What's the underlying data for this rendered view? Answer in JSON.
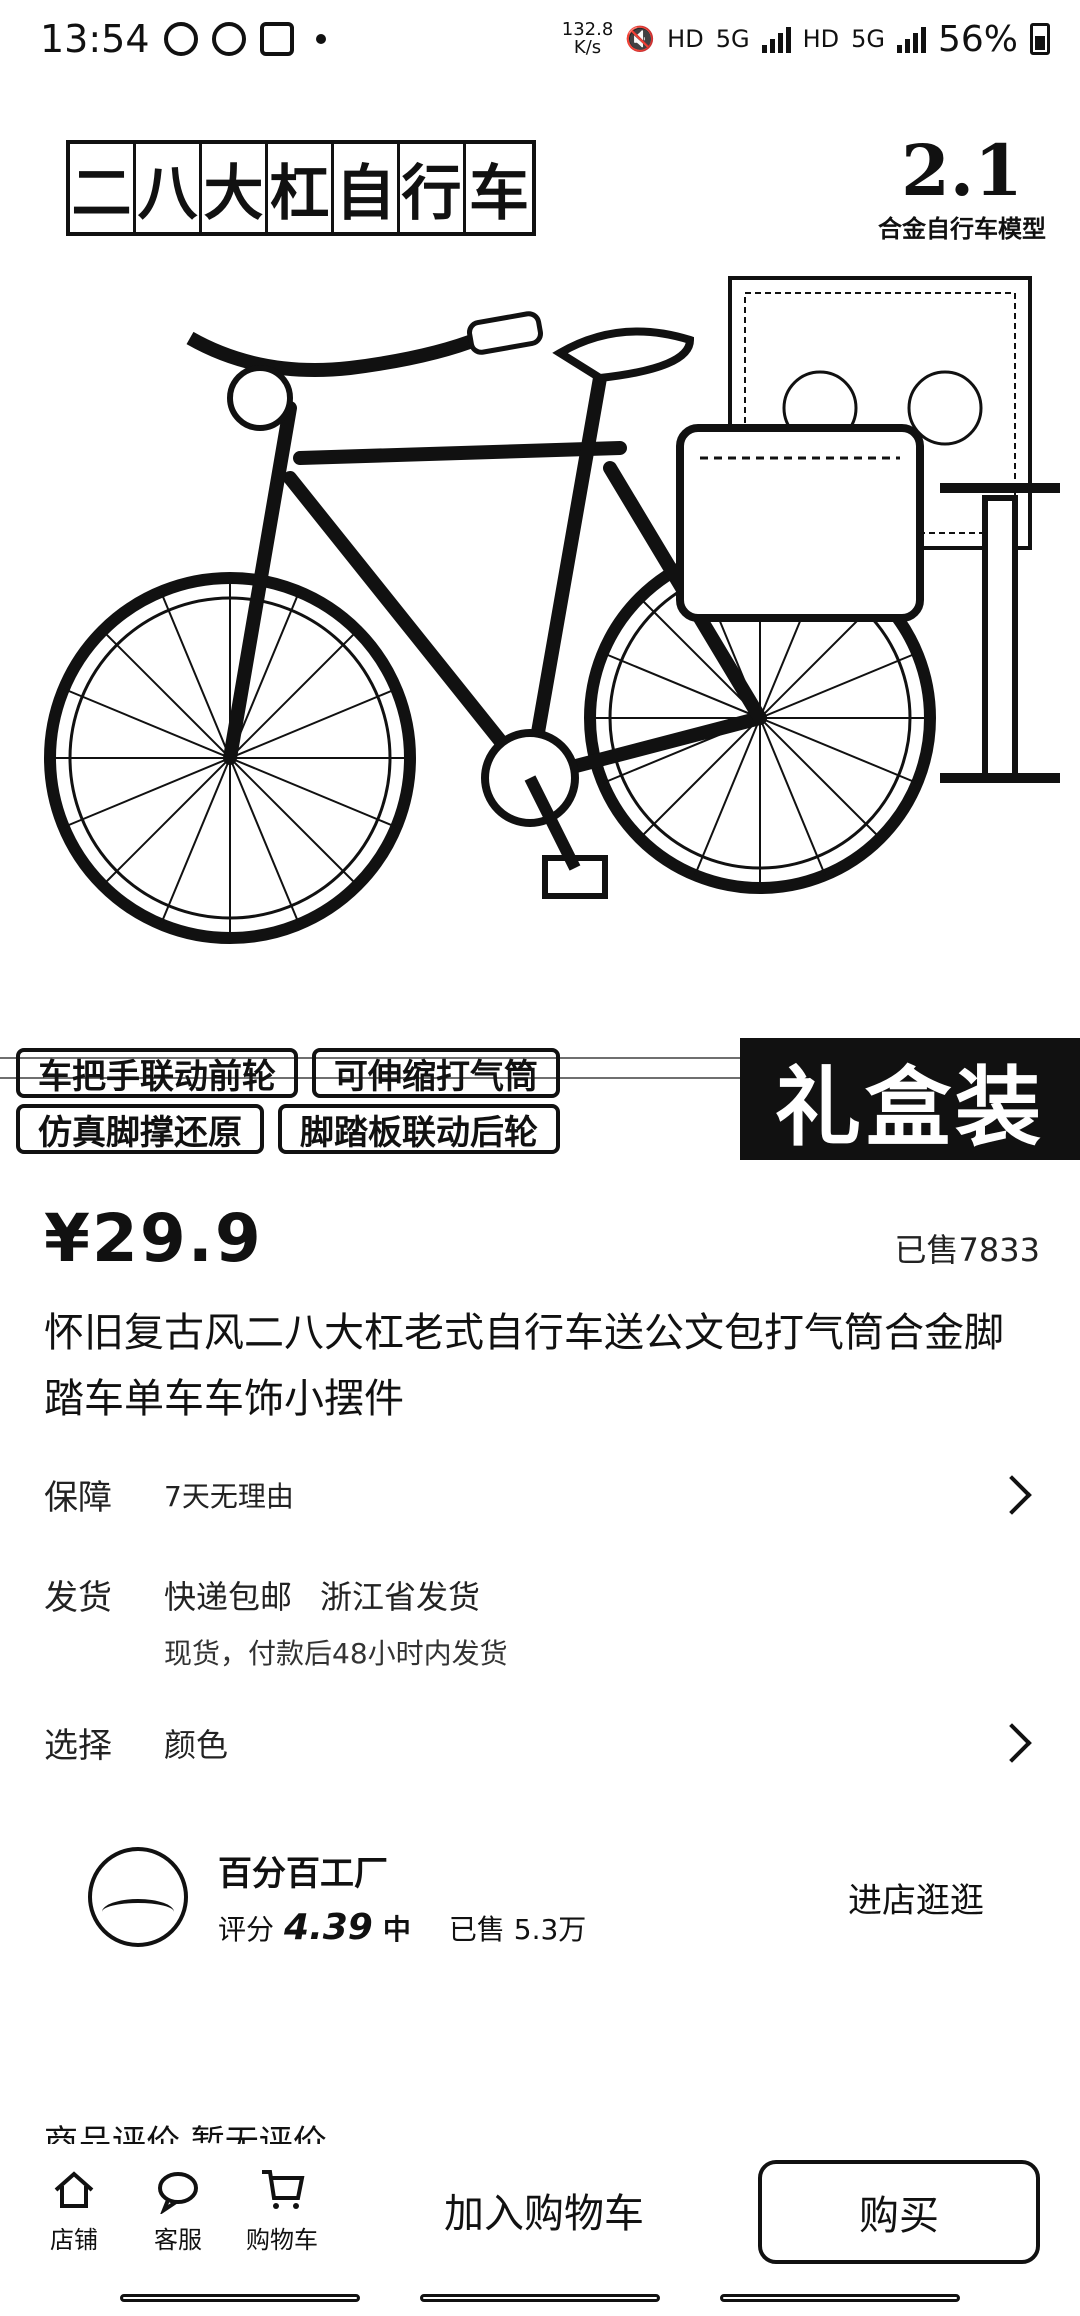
{
  "status_bar": {
    "time": "13:54",
    "net_speed_value": "132.8",
    "net_speed_unit": "K/s",
    "hd1": "HD",
    "net1": "5G",
    "hd2": "HD",
    "net2": "5G",
    "battery": "56%"
  },
  "product_image": {
    "title_chars": [
      "二",
      "八",
      "大",
      "杠",
      "自",
      "行",
      "车"
    ],
    "brand_logo": "2.1",
    "brand_sub": "合金自行车模型",
    "features_row1": [
      "车把手联动前轮",
      "可伸缩打气筒"
    ],
    "features_row2": [
      "仿真脚撑还原",
      "脚踏板联动后轮"
    ],
    "gift": "礼盒装"
  },
  "price": "¥29.9",
  "sold": "已售7833",
  "product_title": "怀旧复古风二八大杠老式自行车送公文包打气筒合金脚踏车单车车饰小摆件",
  "guarantee": {
    "label": "保障",
    "value": "7天无理由"
  },
  "shipping": {
    "label": "发货",
    "method": "快递包邮",
    "origin": "浙江省发货",
    "note": "现货，付款后48小时内发货"
  },
  "select": {
    "label": "选择",
    "value": "颜色"
  },
  "shop": {
    "name": "百分百工厂",
    "score_label": "评分",
    "score": "4.39",
    "level": "中",
    "sold": "已售 5.3万",
    "enter": "进店逛逛"
  },
  "reviews_peek": "商品评价 暂无评价",
  "bottom_bar": {
    "tabs": [
      "店铺",
      "客服",
      "购物车"
    ],
    "add_cart": "加入购物车",
    "buy": "购买"
  }
}
